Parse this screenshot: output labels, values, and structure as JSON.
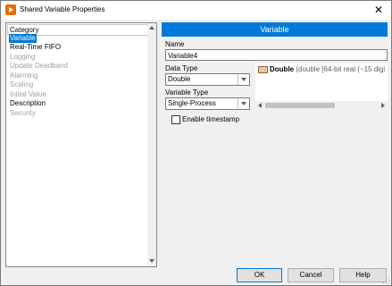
{
  "window": {
    "title": "Shared Variable Properties",
    "close_glyph": "✕"
  },
  "category_panel": {
    "header": "Category",
    "items": [
      {
        "label": "Variable",
        "state": "selected"
      },
      {
        "label": "Real-Time FIFO",
        "state": "enabled"
      },
      {
        "label": "Logging",
        "state": "disabled"
      },
      {
        "label": "Update Deadband",
        "state": "disabled"
      },
      {
        "label": "Alarming",
        "state": "disabled"
      },
      {
        "label": "Scaling",
        "state": "disabled"
      },
      {
        "label": "Initial Value",
        "state": "disabled"
      },
      {
        "label": "Description",
        "state": "enabled"
      },
      {
        "label": "Security",
        "state": "disabled"
      }
    ]
  },
  "page": {
    "header": "Variable",
    "name_label": "Name",
    "name_value": "Variable4",
    "data_type_label": "Data Type",
    "data_type_value": "Double",
    "variable_type_label": "Variable Type",
    "variable_type_value": "Single-Process",
    "type_description_name": "Double",
    "type_description_detail": "(double [64-bit real (~15 digi",
    "timestamp_label": "Enable timestamp",
    "timestamp_checked": false
  },
  "buttons": {
    "ok": "OK",
    "cancel": "Cancel",
    "help": "Help"
  },
  "colors": {
    "accent": "#0078d7",
    "type_swatch": "#f2c49b",
    "app_icon": "#e46c0a"
  }
}
